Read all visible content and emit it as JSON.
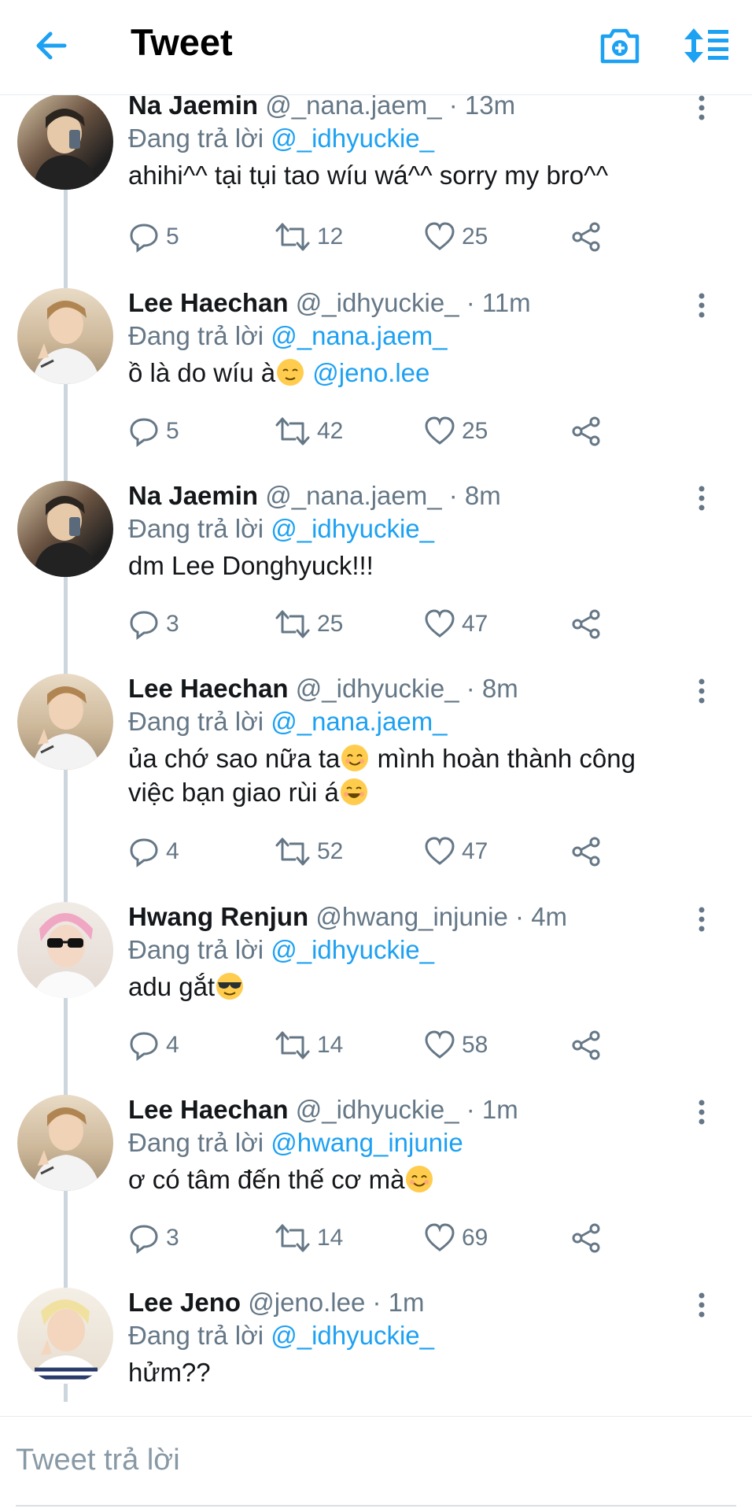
{
  "header": {
    "title": "Tweet",
    "back_icon": "back-arrow-icon",
    "camera_icon": "camera-plus-icon",
    "sort_icon": "sort-icon"
  },
  "colors": {
    "accent": "#1da1f2",
    "secondary_text": "#657786",
    "text": "#14171a"
  },
  "tweets": [
    {
      "name": "Na Jaemin",
      "handle": "@_nana.jaem_",
      "time": "· 13m",
      "reply_prefix": "Đang trả lời",
      "reply_to": "@_idhyuckie_",
      "text": "ahihi^^ tại tụi tao wíu wá^^ sorry my bro^^",
      "replies": "5",
      "retweets": "12",
      "likes": "25"
    },
    {
      "name": "Lee Haechan",
      "handle": "@_idhyuckie_",
      "time": "· 11m",
      "reply_prefix": "Đang trả lời",
      "reply_to": "@_nana.jaem_",
      "text": "ồ là do wíu à",
      "mention": "@jeno.lee",
      "replies": "5",
      "retweets": "42",
      "likes": "25"
    },
    {
      "name": "Na Jaemin",
      "handle": "@_nana.jaem_",
      "time": "· 8m",
      "reply_prefix": "Đang trả lời",
      "reply_to": "@_idhyuckie_",
      "text": "dm Lee Donghyuck!!!",
      "replies": "3",
      "retweets": "25",
      "likes": "47"
    },
    {
      "name": "Lee Haechan",
      "handle": "@_idhyuckie_",
      "time": "· 8m",
      "reply_prefix": "Đang trả lời",
      "reply_to": "@_nana.jaem_",
      "text_line1": "ủa chớ sao nữa ta",
      "text_line1b": " mình hoàn thành công",
      "text_line2": "việc bạn giao rùi á",
      "replies": "4",
      "retweets": "52",
      "likes": "47"
    },
    {
      "name": "Hwang Renjun",
      "handle": "@hwang_injunie",
      "time": "· 4m",
      "reply_prefix": "Đang trả lời",
      "reply_to": "@_idhyuckie_",
      "text": "adu gắt",
      "replies": "4",
      "retweets": "14",
      "likes": "58"
    },
    {
      "name": "Lee Haechan",
      "handle": "@_idhyuckie_",
      "time": "· 1m",
      "reply_prefix": "Đang trả lời",
      "reply_to": "@hwang_injunie",
      "text": "ơ có tâm đến thế cơ mà",
      "replies": "3",
      "retweets": "14",
      "likes": "69"
    },
    {
      "name": "Lee Jeno",
      "handle": "@jeno.lee",
      "time": "· 1m",
      "reply_prefix": "Đang trả lời",
      "reply_to": "@_idhyuckie_",
      "text": "hửm??"
    }
  ],
  "composer": {
    "placeholder": "Tweet trả lời"
  }
}
